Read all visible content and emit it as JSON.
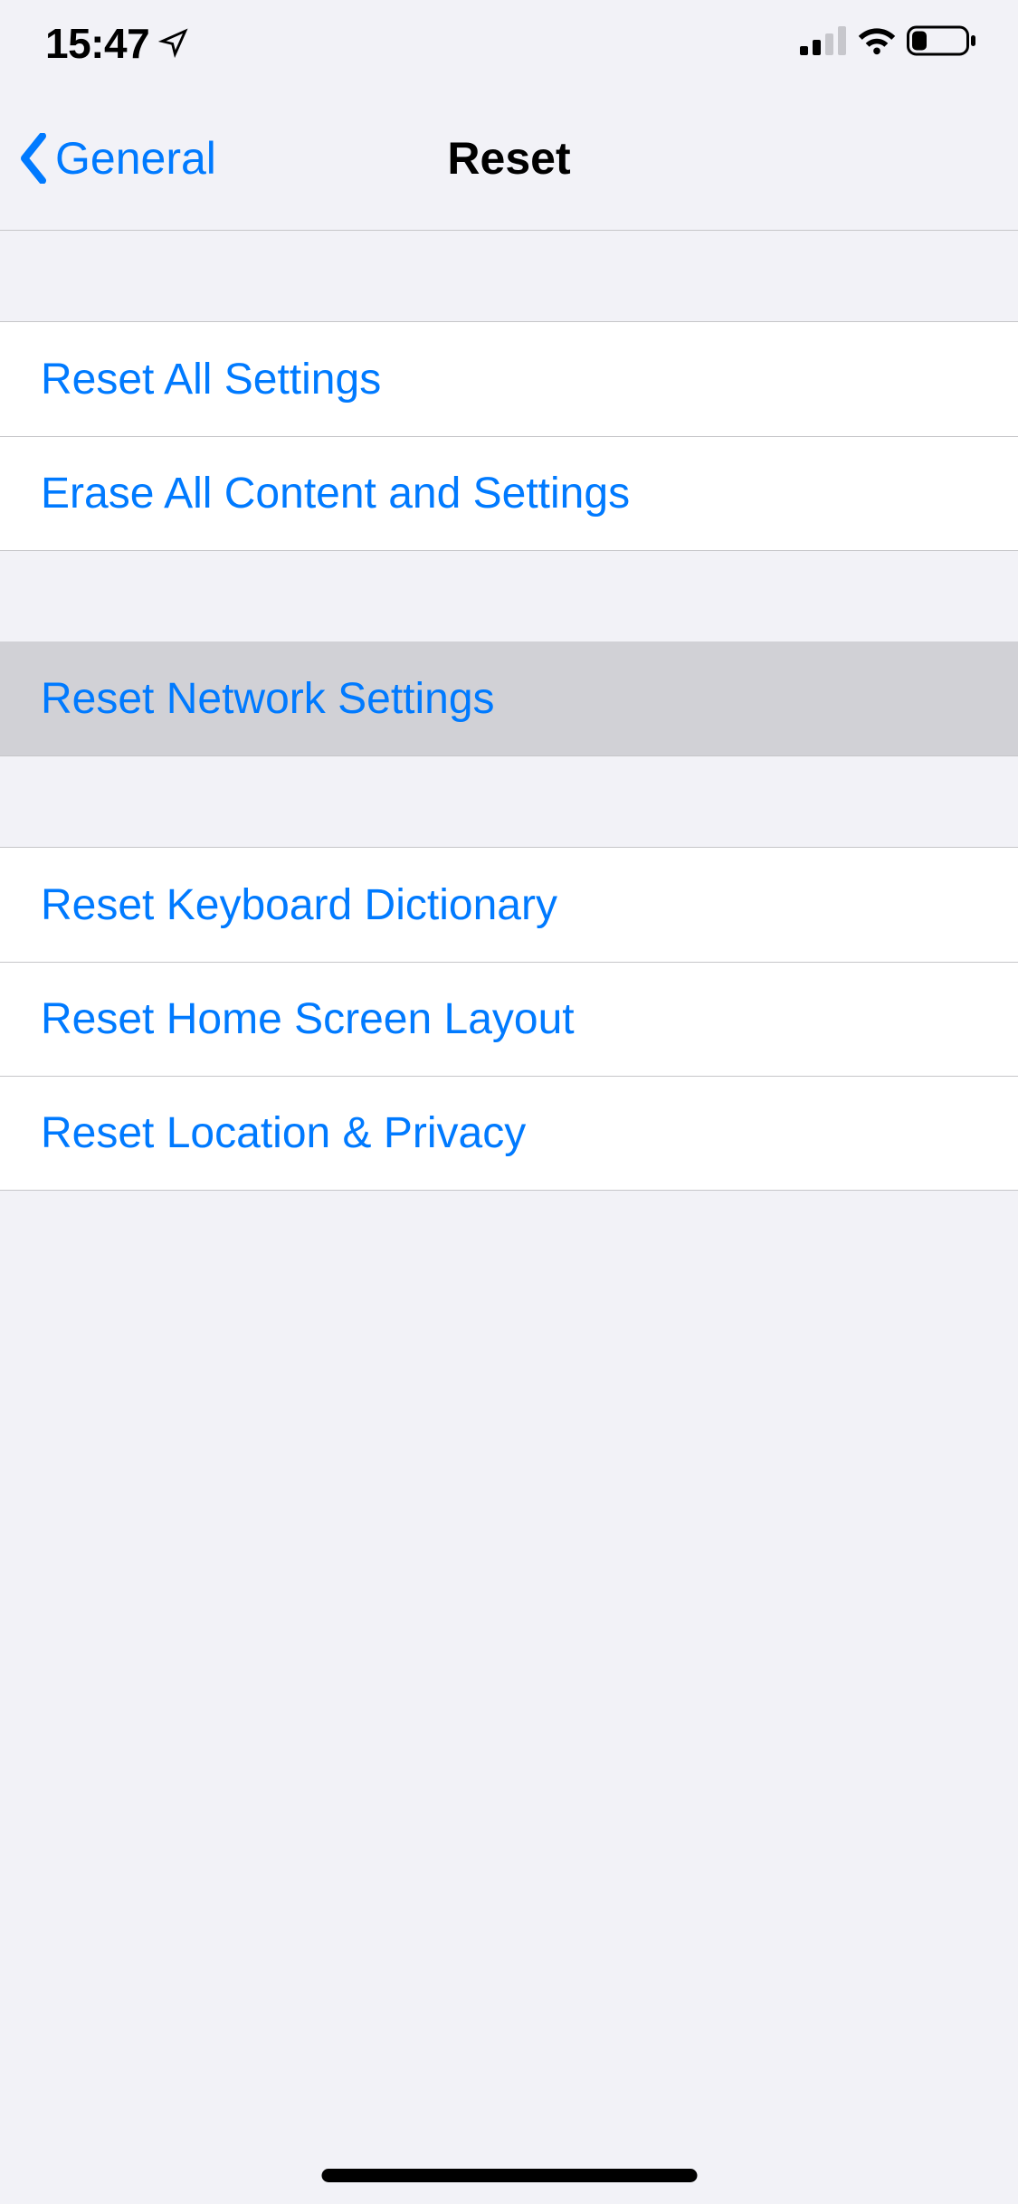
{
  "statusBar": {
    "time": "15:47"
  },
  "nav": {
    "backLabel": "General",
    "title": "Reset"
  },
  "groups": [
    {
      "rows": [
        {
          "label": "Reset All Settings"
        },
        {
          "label": "Erase All Content and Settings"
        }
      ]
    },
    {
      "rows": [
        {
          "label": "Reset Network Settings",
          "pressed": true
        }
      ]
    },
    {
      "rows": [
        {
          "label": "Reset Keyboard Dictionary"
        },
        {
          "label": "Reset Home Screen Layout"
        },
        {
          "label": "Reset Location & Privacy"
        }
      ]
    }
  ]
}
